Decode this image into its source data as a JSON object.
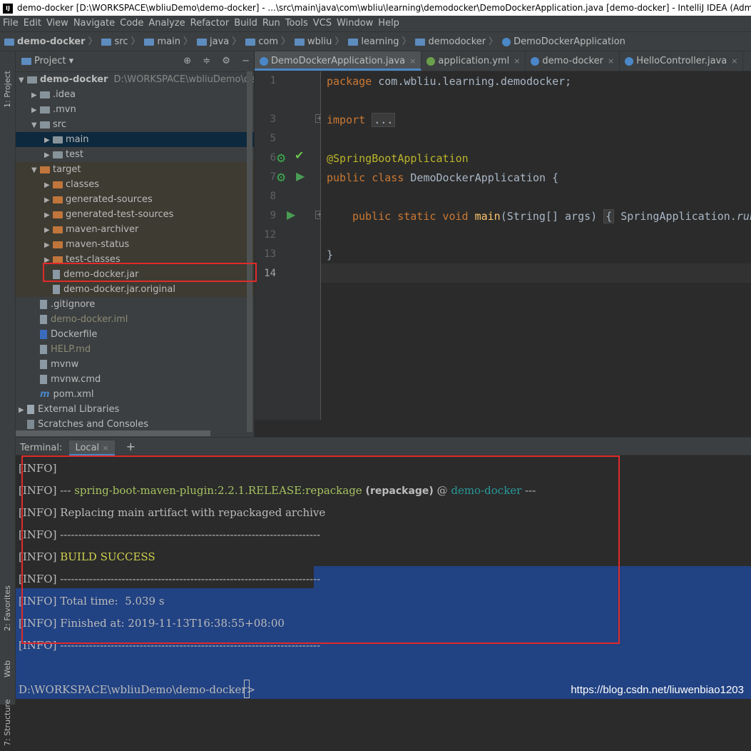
{
  "window": {
    "title": "demo-docker [D:\\WORKSPACE\\wbliuDemo\\demo-docker] - ...\\src\\main\\java\\com\\wbliu\\learning\\demodocker\\DemoDockerApplication.java [demo-docker] - IntelliJ IDEA (Admin",
    "logo": "IJ"
  },
  "menu": [
    "File",
    "Edit",
    "View",
    "Navigate",
    "Code",
    "Analyze",
    "Refactor",
    "Build",
    "Run",
    "Tools",
    "VCS",
    "Window",
    "Help"
  ],
  "breadcrumb": [
    "demo-docker",
    "src",
    "main",
    "java",
    "com",
    "wbliu",
    "learning",
    "demodocker",
    "DemoDockerApplication"
  ],
  "left_stripe": {
    "project": "1: Project",
    "favorites": "2: Favorites",
    "web": "Web",
    "structure": "7: Structure"
  },
  "project": {
    "header": "Project",
    "tree": [
      {
        "label": "demo-docker",
        "extra": "D:\\WORKSPACE\\wbliuDemo\\demo-d",
        "depth": 0,
        "arrow": "▼",
        "icon": "folder",
        "bold": true
      },
      {
        "label": ".idea",
        "depth": 1,
        "arrow": "▶",
        "icon": "folder"
      },
      {
        "label": ".mvn",
        "depth": 1,
        "arrow": "▶",
        "icon": "folder"
      },
      {
        "label": "src",
        "depth": 1,
        "arrow": "▼",
        "icon": "folder"
      },
      {
        "label": "main",
        "depth": 2,
        "arrow": "▶",
        "icon": "folder",
        "state": "sel"
      },
      {
        "label": "test",
        "depth": 2,
        "arrow": "▶",
        "icon": "folder"
      },
      {
        "label": "target",
        "depth": 1,
        "arrow": "▼",
        "icon": "folder-orange",
        "state": "target"
      },
      {
        "label": "classes",
        "depth": 2,
        "arrow": "▶",
        "icon": "folder-orange",
        "state": "target"
      },
      {
        "label": "generated-sources",
        "depth": 2,
        "arrow": "▶",
        "icon": "folder-orange",
        "state": "target"
      },
      {
        "label": "generated-test-sources",
        "depth": 2,
        "arrow": "▶",
        "icon": "folder-orange",
        "state": "target"
      },
      {
        "label": "maven-archiver",
        "depth": 2,
        "arrow": "▶",
        "icon": "folder-orange",
        "state": "target"
      },
      {
        "label": "maven-status",
        "depth": 2,
        "arrow": "▶",
        "icon": "folder-orange",
        "state": "target"
      },
      {
        "label": "test-classes",
        "depth": 2,
        "arrow": "▶",
        "icon": "folder-orange",
        "state": "target"
      },
      {
        "label": "demo-docker.jar",
        "depth": 2,
        "arrow": "",
        "icon": "file",
        "state": "target"
      },
      {
        "label": "demo-docker.jar.original",
        "depth": 2,
        "arrow": "",
        "icon": "file",
        "state": "target"
      },
      {
        "label": ".gitignore",
        "depth": 1,
        "arrow": "",
        "icon": "file"
      },
      {
        "label": "demo-docker.iml",
        "depth": 1,
        "arrow": "",
        "icon": "file",
        "state": "dim"
      },
      {
        "label": "Dockerfile",
        "depth": 1,
        "arrow": "",
        "icon": "docker"
      },
      {
        "label": "HELP.md",
        "depth": 1,
        "arrow": "",
        "icon": "file",
        "state": "dim"
      },
      {
        "label": "mvnw",
        "depth": 1,
        "arrow": "",
        "icon": "file"
      },
      {
        "label": "mvnw.cmd",
        "depth": 1,
        "arrow": "",
        "icon": "file"
      },
      {
        "label": "pom.xml",
        "depth": 1,
        "arrow": "",
        "icon": "maven"
      },
      {
        "label": "External Libraries",
        "depth": 0,
        "arrow": "▶",
        "icon": "lib"
      },
      {
        "label": "Scratches and Consoles",
        "depth": 0,
        "arrow": "",
        "icon": "scratch"
      }
    ]
  },
  "tabs": [
    {
      "label": "DemoDockerApplication.java",
      "icon_color": "#4a88c7",
      "active": true
    },
    {
      "label": "application.yml",
      "icon_color": "#6a9f4a",
      "active": false
    },
    {
      "label": "demo-docker",
      "icon_color": "#4a86c8",
      "active": false
    },
    {
      "label": "HelloController.java",
      "icon_color": "#4a88c7",
      "active": false
    }
  ],
  "editor": {
    "line_numbers": [
      "1",
      "3",
      "5",
      "6",
      "7",
      "8",
      "9",
      "12",
      "13",
      "14"
    ],
    "package_kw": "package",
    "package_name": "com.wbliu.learning.demodocker;",
    "import_kw": "import",
    "import_fold": "...",
    "annotation": "@SpringBootApplication",
    "class_kw": "public class",
    "class_name": "DemoDockerApplication {",
    "method_kw": "public static void",
    "method_name": "main",
    "method_args": "(String[] args)",
    "method_body_open": "{",
    "method_body": "SpringApplication.",
    "method_call": "run",
    "close_brace": "}"
  },
  "terminal": {
    "label": "Terminal:",
    "tab": "Local",
    "add": "+",
    "lines": {
      "l1": "[INFO]",
      "l2_prefix": "[INFO] --- ",
      "l2_plugin": "spring-boot-maven-plugin:2.2.1.RELEASE:repackage",
      "l2_goal": " (repackage)",
      "l2_at": " @ ",
      "l2_project": "demo-docker",
      "l2_suffix": " ---",
      "l3": "[INFO] Replacing main artifact with repackaged archive",
      "l4": "[INFO] ------------------------------------------------------------------------",
      "l5_prefix": "[INFO] ",
      "l5_status": "BUILD SUCCESS",
      "l6": "[INFO] ------------------------------------------------------------------------",
      "l7": "[INFO] Total time:  5.039 s",
      "l8": "[INFO] Finished at: 2019-11-13T16:38:55+08:00",
      "l9": "[INFO] ------------------------------------------------------------------------",
      "prompt": "D:\\WORKSPACE\\wbliuDemo\\demo-docker>"
    }
  },
  "watermark": "https://blog.csdn.net/liuwenbiao1203"
}
